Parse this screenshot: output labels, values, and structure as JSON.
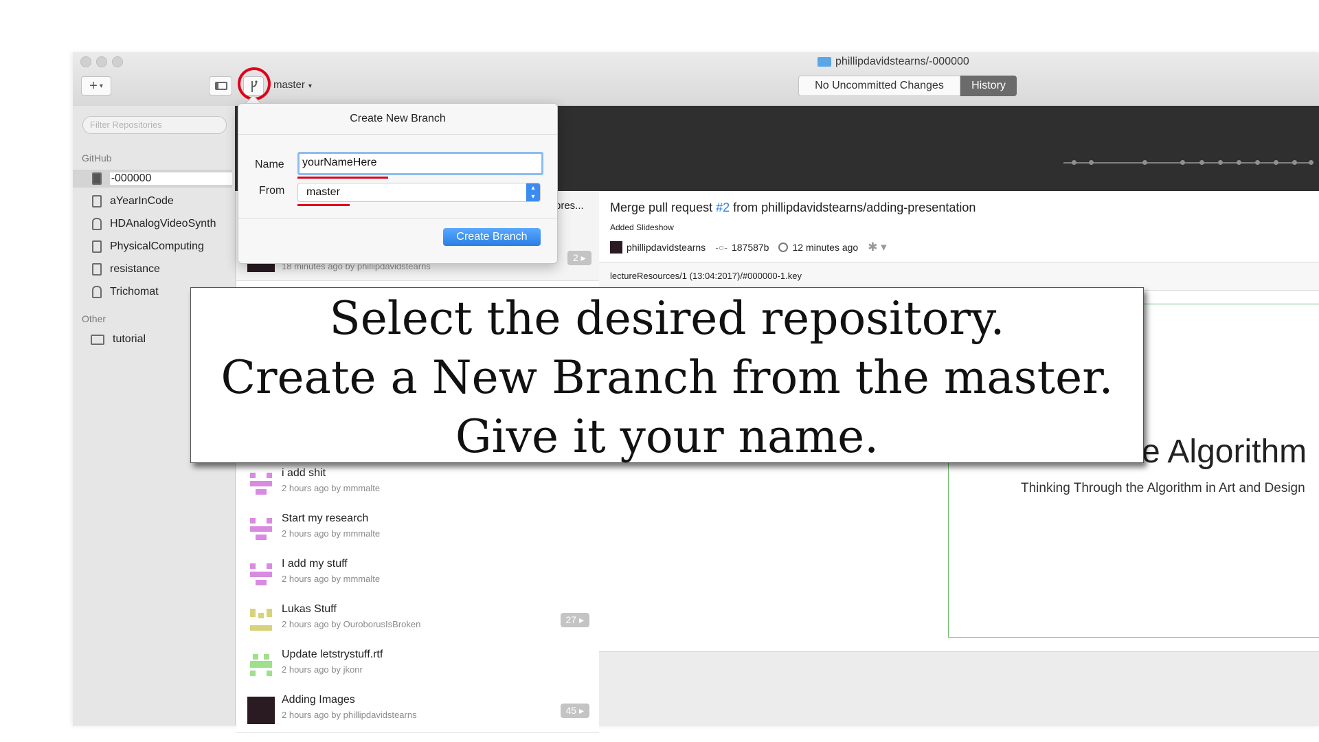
{
  "window": {
    "title": "phillipdavidstearns/-000000",
    "branch_selector": "master",
    "add_label": "+",
    "toggle_changes": "No Uncommitted Changes",
    "toggle_history": "History"
  },
  "sidebar": {
    "filter_placeholder": "Filter Repositories",
    "github_label": "GitHub",
    "github_repos": [
      {
        "name": "-000000",
        "icon": "book-icon"
      },
      {
        "name": "aYearInCode",
        "icon": "book-icon"
      },
      {
        "name": "HDAnalogVideoSynth",
        "icon": "lock-icon"
      },
      {
        "name": "PhysicalComputing",
        "icon": "book-icon"
      },
      {
        "name": "resistance",
        "icon": "fork-icon"
      },
      {
        "name": "Trichomat",
        "icon": "lock-icon"
      }
    ],
    "other_label": "Other",
    "other_repos": [
      {
        "name": "tutorial",
        "icon": "monitor-icon"
      }
    ]
  },
  "popover": {
    "title": "Create New Branch",
    "name_label": "Name",
    "name_value": "yourNameHere",
    "from_label": "From",
    "from_value": "master",
    "create_button": "Create Branch"
  },
  "commits_partial": {
    "title_fragment": "pres...",
    "meta": "18 minutes ago by phillipdavidstearns",
    "badge": "2"
  },
  "commits": [
    {
      "title": "i add shit",
      "meta": "2 hours ago by mmmalte",
      "badge": ""
    },
    {
      "title": "Start my research",
      "meta": "2 hours ago by mmmalte",
      "badge": ""
    },
    {
      "title": "I add my stuff",
      "meta": "2 hours ago by mmmalte",
      "badge": ""
    },
    {
      "title": "Lukas Stuff",
      "meta": "2 hours ago by OuroborusIsBroken",
      "badge": "27"
    },
    {
      "title": "Update letstrystuff.rtf",
      "meta": "2 hours ago by jkonr",
      "badge": ""
    },
    {
      "title": "Adding Images",
      "meta": "2 hours ago by phillipdavidstearns",
      "badge": "45"
    }
  ],
  "detail": {
    "title_prefix": "Merge pull request",
    "pr_number": "#2",
    "title_suffix": "from phillipdavidstearns/adding-presentation",
    "description": "Added Slideshow",
    "author": "phillipdavidstearns",
    "sha": "187587b",
    "time": "12 minutes ago",
    "file_path": "lectureResources/1 (13:04:2017)/#000000-1.key",
    "preview_heading": "e Algorithm",
    "preview_sub": "Thinking Through the Algorithm in Art and Design"
  },
  "overlay": {
    "line1": "Select the desired repository.",
    "line2": "Create a New Branch from the master.",
    "line3": "Give it your name."
  },
  "colors": {
    "highlight_circle": "#e0001b",
    "accent_blue": "#2a7fe3",
    "dark_header": "#2f2f2f"
  }
}
